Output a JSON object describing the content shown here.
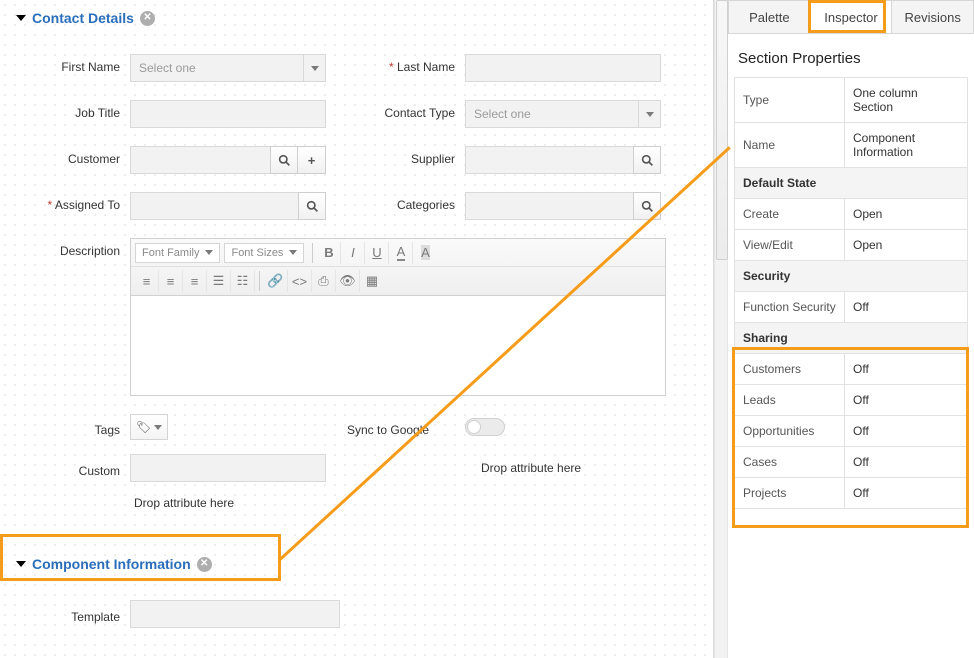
{
  "sections": {
    "contact_details": "Contact Details",
    "component_info": "Component Information"
  },
  "labels": {
    "first_name": "First Name",
    "last_name": "Last Name",
    "job_title": "Job Title",
    "contact_type": "Contact Type",
    "customer": "Customer",
    "supplier": "Supplier",
    "assigned_to": "Assigned To",
    "categories": "Categories",
    "description": "Description",
    "tags": "Tags",
    "sync_google": "Sync to Google",
    "custom": "Custom",
    "template": "Template"
  },
  "placeholders": {
    "select_one": "Select one",
    "font_family": "Font Family",
    "font_sizes": "Font Sizes"
  },
  "hints": {
    "drop_here": "Drop attribute here"
  },
  "tabs": {
    "palette": "Palette",
    "inspector": "Inspector",
    "revisions": "Revisions"
  },
  "props": {
    "title": "Section Properties",
    "type_k": "Type",
    "type_v": "One column Section",
    "name_k": "Name",
    "name_v": "Component Information",
    "default_state": "Default State",
    "create_k": "Create",
    "create_v": "Open",
    "viewedit_k": "View/Edit",
    "viewedit_v": "Open",
    "security": "Security",
    "funcsec_k": "Function Security",
    "funcsec_v": "Off",
    "sharing": "Sharing",
    "customers_k": "Customers",
    "customers_v": "Off",
    "leads_k": "Leads",
    "leads_v": "Off",
    "opps_k": "Opportunities",
    "opps_v": "Off",
    "cases_k": "Cases",
    "cases_v": "Off",
    "projects_k": "Projects",
    "projects_v": "Off"
  }
}
